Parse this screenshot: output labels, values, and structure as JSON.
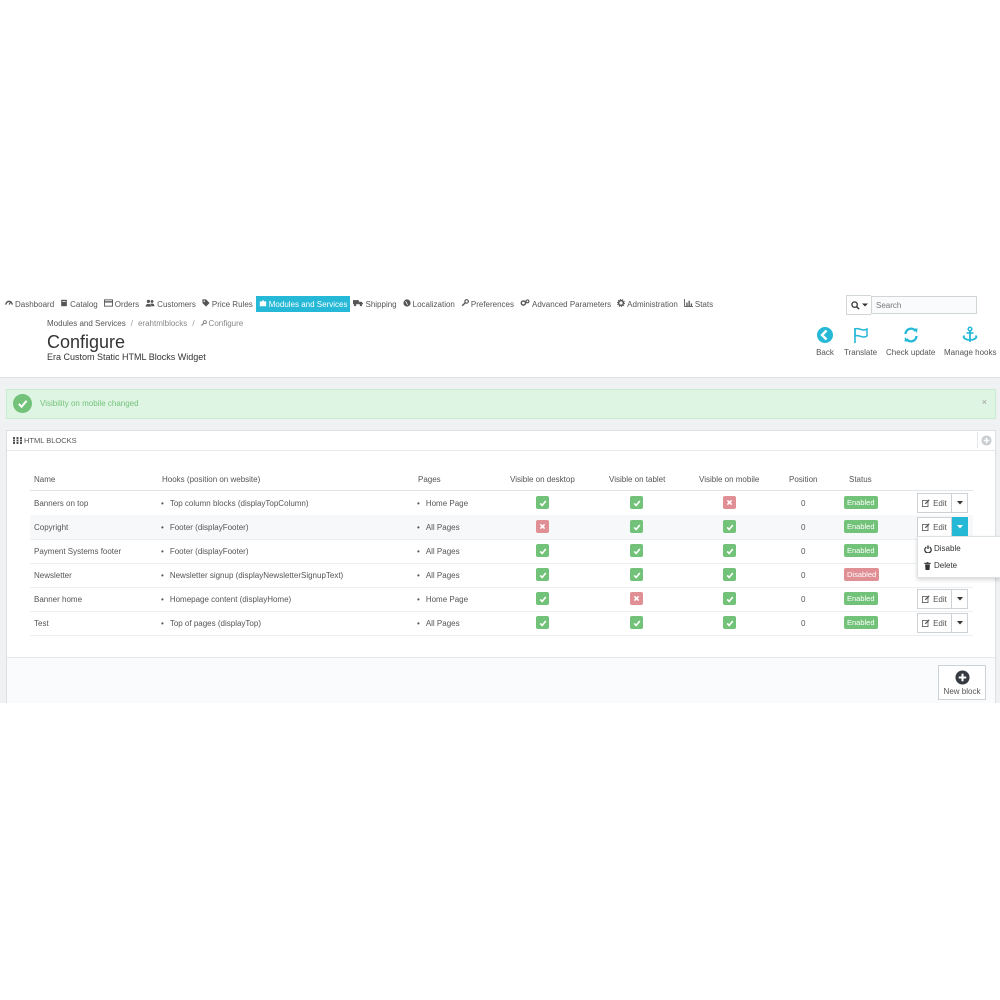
{
  "nav": {
    "items": [
      {
        "label": "Dashboard",
        "icon": "dashboard-icon",
        "active": false
      },
      {
        "label": "Catalog",
        "icon": "book-icon",
        "active": false
      },
      {
        "label": "Orders",
        "icon": "credit-card-icon",
        "active": false
      },
      {
        "label": "Customers",
        "icon": "users-icon",
        "active": false
      },
      {
        "label": "Price Rules",
        "icon": "tags-icon",
        "active": false
      },
      {
        "label": "Modules and Services",
        "icon": "puzzle-icon",
        "active": true
      },
      {
        "label": "Shipping",
        "icon": "truck-icon",
        "active": false
      },
      {
        "label": "Localization",
        "icon": "globe-icon",
        "active": false
      },
      {
        "label": "Preferences",
        "icon": "wrench-icon",
        "active": false
      },
      {
        "label": "Advanced Parameters",
        "icon": "cogs-icon",
        "active": false
      },
      {
        "label": "Administration",
        "icon": "gear-icon",
        "active": false
      },
      {
        "label": "Stats",
        "icon": "bar-chart-icon",
        "active": false
      }
    ],
    "search_placeholder": "Search"
  },
  "breadcrumb": {
    "root": "Modules and Services",
    "module": "erahtmlblocks",
    "current": "Configure"
  },
  "page": {
    "title": "Configure",
    "subtitle": "Era Custom Static HTML Blocks Widget"
  },
  "toolbar": {
    "back": "Back",
    "translate": "Translate",
    "check_update": "Check update",
    "manage_hooks": "Manage hooks"
  },
  "alert": {
    "message": "Visibility on mobile changed",
    "close": "×"
  },
  "panel": {
    "title": "HTML BLOCKS",
    "new_block": "New block"
  },
  "table": {
    "headers": {
      "name": "Name",
      "hooks": "Hooks (position on website)",
      "pages": "Pages",
      "desktop": "Visible on desktop",
      "tablet": "Visible on tablet",
      "mobile": "Visible on mobile",
      "position": "Position",
      "status": "Status"
    },
    "edit_label": "Edit",
    "rows": [
      {
        "name": "Banners on top",
        "hook": "Top column blocks (displayTopColumn)",
        "pages": "Home Page",
        "desktop": true,
        "tablet": true,
        "mobile": false,
        "position": "0",
        "status": "Enabled",
        "enabled": true,
        "has_edit": true
      },
      {
        "name": "Copyright",
        "hook": "Footer (displayFooter)",
        "pages": "All Pages",
        "desktop": false,
        "tablet": true,
        "mobile": true,
        "position": "0",
        "status": "Enabled",
        "enabled": true,
        "has_edit": true
      },
      {
        "name": "Payment Systems footer",
        "hook": "Footer (displayFooter)",
        "pages": "All Pages",
        "desktop": true,
        "tablet": true,
        "mobile": true,
        "position": "0",
        "status": "Enabled",
        "enabled": true,
        "has_edit": false
      },
      {
        "name": "Newsletter",
        "hook": "Newsletter signup (displayNewsletterSignupText)",
        "pages": "All Pages",
        "desktop": true,
        "tablet": true,
        "mobile": true,
        "position": "0",
        "status": "Disabled",
        "enabled": false,
        "has_edit": false
      },
      {
        "name": "Banner home",
        "hook": "Homepage content (displayHome)",
        "pages": "Home Page",
        "desktop": true,
        "tablet": false,
        "mobile": true,
        "position": "0",
        "status": "Enabled",
        "enabled": true,
        "has_edit": true
      },
      {
        "name": "Test",
        "hook": "Top of pages (displayTop)",
        "pages": "All Pages",
        "desktop": true,
        "tablet": true,
        "mobile": true,
        "position": "0",
        "status": "Enabled",
        "enabled": true,
        "has_edit": true
      }
    ]
  },
  "dropdown": {
    "disable": "Disable",
    "delete": "Delete"
  },
  "colors": {
    "accent": "#25b9d7",
    "success": "#72c279",
    "danger": "#e08f95"
  }
}
